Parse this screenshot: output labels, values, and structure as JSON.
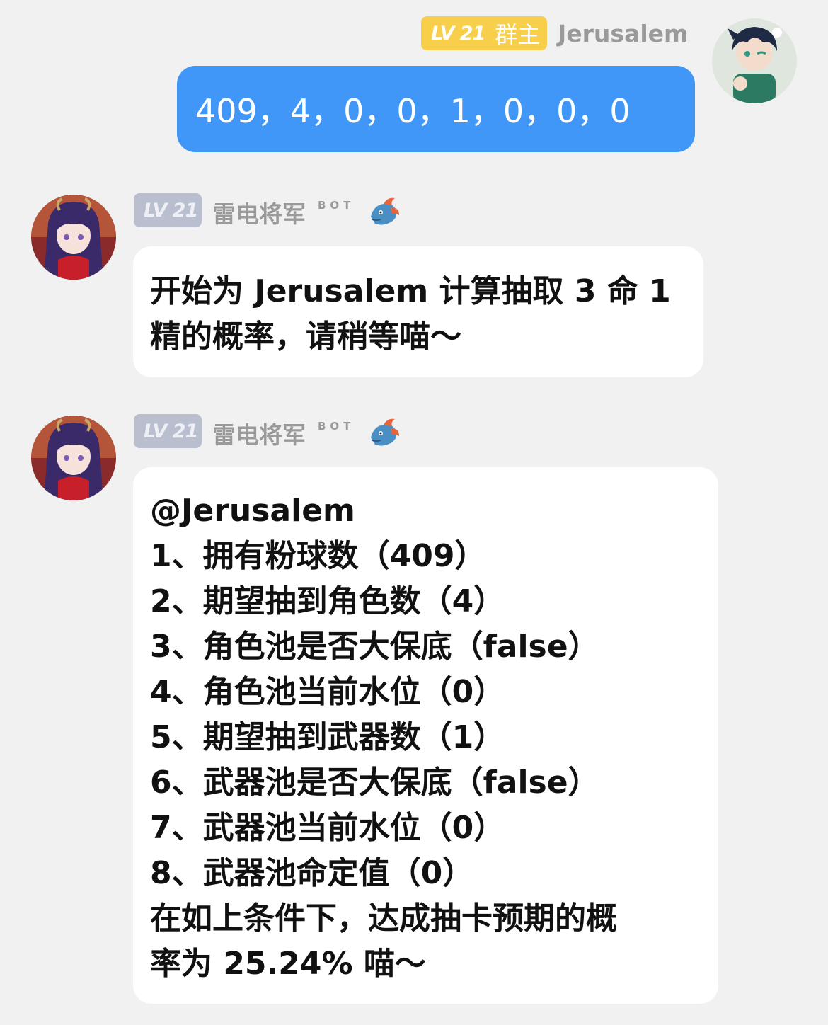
{
  "message_user": {
    "level": "LV 21",
    "role": "群主",
    "name": "Jerusalem",
    "text": "409，4，0，0，1，0，0，0"
  },
  "message_bot_1": {
    "level": "LV 21",
    "name": "雷电将军",
    "tag": "BOT",
    "lines": [
      "开始为 Jerusalem 计算抽取 3 命 1",
      "精的概率，请稍等喵～"
    ]
  },
  "message_bot_2": {
    "level": "LV 21",
    "name": "雷电将军",
    "tag": "BOT",
    "lines": [
      "@Jerusalem",
      "1、拥有粉球数（409）",
      "2、期望抽到角色数（4）",
      "3、角色池是否大保底（false）",
      "4、角色池当前水位（0）",
      "5、期望抽到武器数（1）",
      "6、武器池是否大保底（false）",
      "7、武器池当前水位（0）",
      "8、武器池命定值（0）",
      "在如上条件下，达成抽卡预期的概",
      "率为 25.24% 喵～"
    ]
  },
  "colors": {
    "background": "#f1f1f1",
    "user_bubble": "#4197f7",
    "owner_badge": "#f7cf4b",
    "member_badge": "#b9bfcf",
    "bot_bubble": "#ffffff"
  },
  "icons": {
    "user_avatar": "user-avatar",
    "bot_avatar": "bot-avatar",
    "bot_badge": "dragon-icon"
  }
}
